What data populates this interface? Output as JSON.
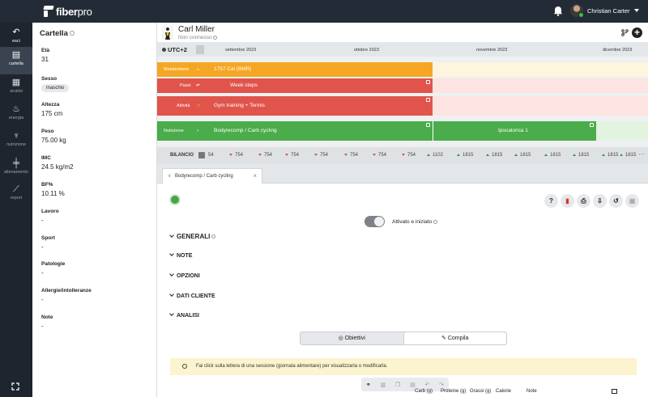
{
  "app": {
    "name_bold": "fiber",
    "name_light": "pro"
  },
  "user": {
    "name": "Christian Carter"
  },
  "nav": [
    {
      "label": "esci",
      "icon": "back-arrow-icon",
      "glyph": "↶"
    },
    {
      "label": "cartella",
      "icon": "clipboard-icon",
      "glyph": "▤"
    },
    {
      "label": "analisi",
      "icon": "document-icon",
      "glyph": "▦"
    },
    {
      "label": "energia",
      "icon": "flame-icon",
      "glyph": "♨"
    },
    {
      "label": "nutrizione",
      "icon": "fork-knife-icon",
      "glyph": "♆"
    },
    {
      "label": "allenamento",
      "icon": "dumbbell-icon",
      "glyph": "╪"
    },
    {
      "label": "report",
      "icon": "chart-icon",
      "glyph": "⟋"
    }
  ],
  "panel": {
    "title": "Cartella",
    "fields": [
      {
        "key": "Età",
        "value": "31"
      },
      {
        "key": "Sesso",
        "chip": "maschio"
      },
      {
        "key": "Altezza",
        "value": "175 cm"
      },
      {
        "key": "Peso",
        "value": "75.00 kg"
      },
      {
        "key": "IMC",
        "value": "24.5 kg/m2"
      },
      {
        "key": "BF%",
        "value": "10.11 %"
      },
      {
        "key": "Lavoro",
        "value": "-"
      },
      {
        "key": "Sport",
        "value": "-"
      },
      {
        "key": "Patologie",
        "value": "-"
      },
      {
        "key": "Allergie/intolleranze",
        "value": "-"
      },
      {
        "key": "Note",
        "value": "-"
      }
    ]
  },
  "client": {
    "name": "Carl Miller",
    "status": "Non connesso"
  },
  "timeline": {
    "timezone": "UTC+2",
    "months": [
      "settembre 2023",
      "ottobre 2023",
      "novembre 2023",
      "dicembre 2023"
    ],
    "rows": [
      {
        "label": "Metabolismo",
        "bar": "1757 Cal (BMR)",
        "color": "#f5a623",
        "rest": "#fdf5dd"
      },
      {
        "label": "Passi",
        "bar": "Week steps",
        "color": "#e0544b",
        "rest": "#fde3e1"
      },
      {
        "label": "Attività",
        "bar": "Gym training + Tennis",
        "color": "#e0544b",
        "rest": "#fde3e1"
      },
      {
        "label": "Nutrizione",
        "bar": "Bodyrecomp / Carb cycling",
        "bar2": "Ipocalorica 1",
        "color": "#4aac4a",
        "rest": "#e2f3df"
      }
    ],
    "balance": {
      "label": "BILANCIO",
      "values": [
        {
          "v": "54",
          "dir": "none"
        },
        {
          "v": "754",
          "dir": "down"
        },
        {
          "v": "754",
          "dir": "down"
        },
        {
          "v": "754",
          "dir": "down"
        },
        {
          "v": "754",
          "dir": "down"
        },
        {
          "v": "754",
          "dir": "down"
        },
        {
          "v": "754",
          "dir": "down"
        },
        {
          "v": "754",
          "dir": "down"
        },
        {
          "v": "1102",
          "dir": "up"
        },
        {
          "v": "1815",
          "dir": "up"
        },
        {
          "v": "1815",
          "dir": "up"
        },
        {
          "v": "1815",
          "dir": "up"
        },
        {
          "v": "1815",
          "dir": "up"
        },
        {
          "v": "1815",
          "dir": "up"
        },
        {
          "v": "1815",
          "dir": "up"
        },
        {
          "v": "1815",
          "dir": "up"
        }
      ],
      "more": "···"
    }
  },
  "tab": {
    "label": "Bodyrecomp / Carb cycling"
  },
  "plan": {
    "toggle_label": "Attivato e iniziato",
    "sections": [
      "GENERALI",
      "NOTE",
      "OPZIONI",
      "DATI CLIENTE",
      "ANALISI"
    ],
    "segments": [
      "Obiettivi",
      "Compila"
    ],
    "info": "Fai click sulla lettera di una sessione (giornata alimentare) per visualizzarla o modificarla.",
    "columns": [
      "Carb (g)",
      "Proteine (g)",
      "Grassi (g)",
      "Calorie",
      "Note"
    ]
  },
  "colors": {
    "topbar": "#232b36",
    "nav": "#1f252e",
    "green": "#4aac4a",
    "red": "#e0544b",
    "orange": "#f5a623"
  }
}
